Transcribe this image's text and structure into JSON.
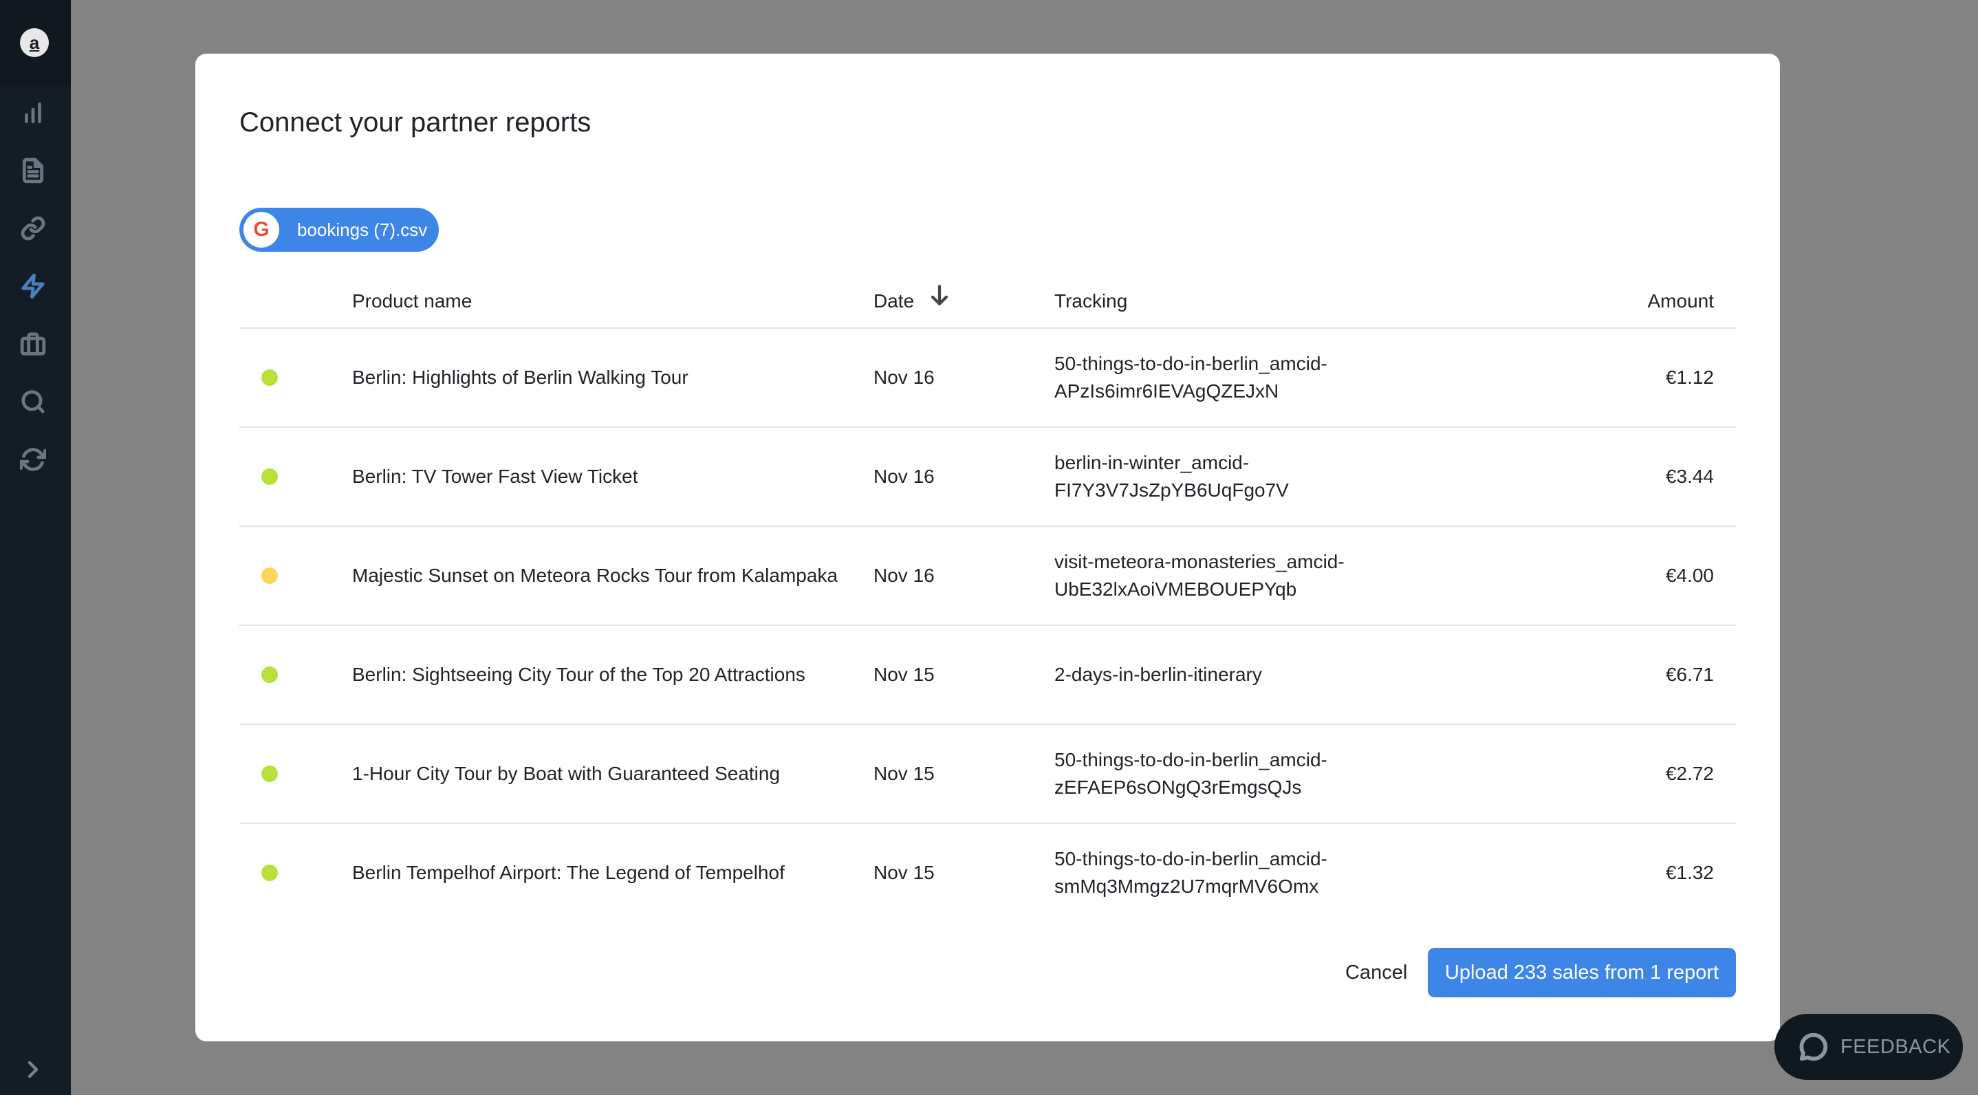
{
  "sidebar": {
    "logo_letter": "a",
    "icons": [
      "chart-icon",
      "document-icon",
      "link-icon",
      "lightning-icon",
      "briefcase-icon",
      "search-icon",
      "refresh-icon"
    ],
    "active_icon": "lightning-icon",
    "collapse_icon": "chevron-right-icon"
  },
  "modal": {
    "title": "Connect your partner reports",
    "file_chip": {
      "logo_letter": "G",
      "label": "bookings (7).csv"
    },
    "table": {
      "headers": {
        "product": "Product name",
        "date": "Date",
        "tracking": "Tracking",
        "amount": "Amount"
      },
      "sort_icon": "arrow-down-icon",
      "status_colors": {
        "ok": "#b8e03a",
        "warning": "#fdd45c"
      },
      "rows": [
        {
          "status": "ok",
          "product": "Berlin: Highlights of Berlin Walking Tour",
          "date": "Nov 16",
          "tracking_line1": "50-things-to-do-in-berlin_amcid-",
          "tracking_line2": "APzIs6imr6IEVAgQZEJxN",
          "amount": "€1.12"
        },
        {
          "status": "ok",
          "product": "Berlin: TV Tower Fast View Ticket",
          "date": "Nov 16",
          "tracking_line1": "berlin-in-winter_amcid-",
          "tracking_line2": "FI7Y3V7JsZpYB6UqFgo7V",
          "amount": "€3.44"
        },
        {
          "status": "warning",
          "product": "Majestic Sunset on Meteora Rocks Tour from Kalampaka",
          "date": "Nov 16",
          "tracking_line1": "visit-meteora-monasteries_amcid-",
          "tracking_line2": "UbE32lxAoiVMEBOUEPYqb",
          "amount": "€4.00"
        },
        {
          "status": "ok",
          "product": "Berlin: Sightseeing City Tour of the Top 20 Attractions",
          "date": "Nov 15",
          "tracking_line1": "2-days-in-berlin-itinerary",
          "tracking_line2": "",
          "amount": "€6.71"
        },
        {
          "status": "ok",
          "product": "1-Hour City Tour by Boat with Guaranteed Seating",
          "date": "Nov 15",
          "tracking_line1": "50-things-to-do-in-berlin_amcid-",
          "tracking_line2": "zEFAEP6sONgQ3rEmgsQJs",
          "amount": "€2.72"
        },
        {
          "status": "ok",
          "product": "Berlin Tempelhof Airport: The Legend of Tempelhof",
          "date": "Nov 15",
          "tracking_line1": "50-things-to-do-in-berlin_amcid-",
          "tracking_line2": "smMq3Mmgz2U7mqrMV6Omx",
          "amount": "€1.32"
        }
      ]
    },
    "cancel_label": "Cancel",
    "upload_label": "Upload 233 sales from 1 report"
  },
  "feedback": {
    "label": "FEEDBACK",
    "icon": "chat-bubble-icon"
  },
  "colors": {
    "accent": "#3d86e8",
    "sidebar_bg": "#141d26"
  }
}
